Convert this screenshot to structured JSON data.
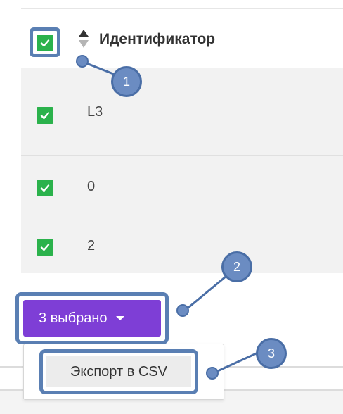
{
  "table": {
    "header": {
      "label": "Идентификатор",
      "select_all_checked": true
    },
    "rows": [
      {
        "id": "L3",
        "checked": true
      },
      {
        "id": "0",
        "checked": true
      },
      {
        "id": "2",
        "checked": true
      }
    ]
  },
  "selection": {
    "button_label": "3 выбрано"
  },
  "dropdown": {
    "items": [
      {
        "label": "Экспорт в CSV"
      }
    ]
  },
  "callouts": [
    "1",
    "2",
    "3"
  ],
  "colors": {
    "checkbox": "#2bb24c",
    "primary_button": "#7e3ed6",
    "callout": "#6b8cc2",
    "highlight_frame": "#5a7fb3",
    "row_background": "#f2f2f2"
  }
}
